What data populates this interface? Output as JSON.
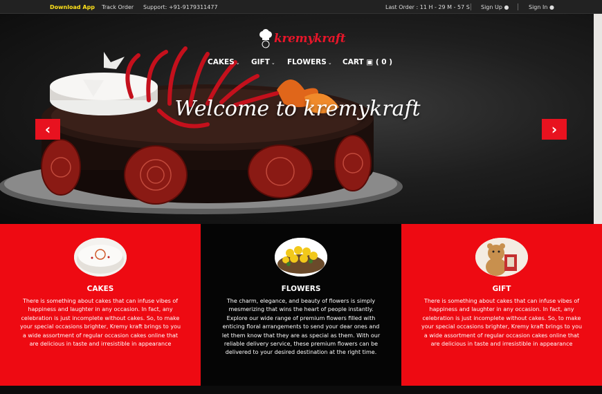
{
  "topbar": {
    "download_app": "Download App",
    "track_order": "Track Order",
    "support": "Support: +91-9179311477",
    "last_order": "Last Order : 11 H - 29 M - 57 S",
    "sign_up": "Sign Up",
    "sign_in": "Sign In"
  },
  "brand": {
    "name": "kremykraft",
    "color": "#e8162a"
  },
  "nav": {
    "cakes": "CAKES",
    "gift": "GIFT",
    "flowers": "FLOWERS",
    "cart": "CART",
    "cart_count": "( 0 )"
  },
  "hero": {
    "heading": "Welcome to kremykraft"
  },
  "categories": [
    {
      "title": "CAKES",
      "text": "There is something about cakes that can infuse vibes of happiness and laughter in any occasion. In fact, any celebration is just incomplete without cakes. So, to make your special occasions brighter, Kremy kraft brings to you a wide assortment of regular occasion cakes online that are delicious in taste and irresistible in appearance",
      "bg": "#ee0a12"
    },
    {
      "title": "FLOWERS",
      "text": "The charm, elegance, and beauty of flowers is simply mesmerizing that wins the heart of people instantly. Explore our wide range of premium flowers filled with enticing floral arrangements to send your dear ones and let them know that they are as special as them. With our reliable delivery service, these premium flowers can be delivered to your desired destination at the right time.",
      "bg": "#050505"
    },
    {
      "title": "GIFT",
      "text": "There is something about cakes that can infuse vibes of happiness and laughter in any occasion. In fact, any celebration is just incomplete without cakes. So, to make your special occasions brighter, Kremy kraft brings to you a wide assortment of regular occasion cakes online that are delicious in taste and irresistible in appearance",
      "bg": "#ee0a12"
    }
  ],
  "icons": [
    "user-icon",
    "cart-icon",
    "chevron-down-icon",
    "chevron-left-icon",
    "chevron-right-icon",
    "chef-hat-icon"
  ]
}
